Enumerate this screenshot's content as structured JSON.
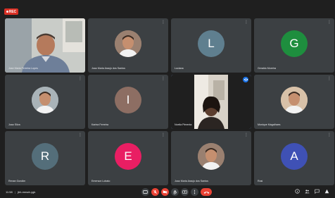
{
  "recording": {
    "label": "REC"
  },
  "participants": [
    {
      "name": "Jose Maria Ferreira Lopes",
      "type": "video",
      "scene": "man-office"
    },
    {
      "name": "Joao Maria Araujo dos Santos",
      "type": "photo",
      "avatar_color": "#9a8070"
    },
    {
      "name": "Luciana",
      "type": "letter",
      "letter": "L",
      "avatar_color": "#5f7f8f"
    },
    {
      "name": "Geraldo Moreira",
      "type": "letter",
      "letter": "G",
      "avatar_color": "#1e8e3e"
    },
    {
      "name": "Joao Silva",
      "type": "photo",
      "avatar_color": "#a9b3b8"
    },
    {
      "name": "Karina Ferreira",
      "type": "letter",
      "letter": "I",
      "avatar_color": "#8d6e63"
    },
    {
      "name": "Noelia Pimenta",
      "type": "video",
      "scene": "woman-room",
      "active": true
    },
    {
      "name": "Monique Magalhaes",
      "type": "photo",
      "avatar_color": "#d8c1a8"
    },
    {
      "name": "Renan Gondim",
      "type": "letter",
      "letter": "R",
      "avatar_color": "#546e7a"
    },
    {
      "name": "Emerson Lobato",
      "type": "letter",
      "letter": "E",
      "avatar_color": "#e91e63"
    },
    {
      "name": "Joao Maria Araujo dos Santos",
      "type": "photo",
      "avatar_color": "#9a8070"
    },
    {
      "name": "Rosi",
      "type": "letter",
      "letter": "A",
      "avatar_color": "#3f51b5"
    }
  ],
  "meeting": {
    "time": "11:58",
    "separator": "|",
    "code": "jbh-mnsdr-ygk"
  },
  "icons": {
    "more": "more-vertical-icon",
    "controls": [
      "captions-icon",
      "mic-off-icon",
      "camera-off-icon",
      "raise-hand-icon",
      "present-icon",
      "more-options-icon",
      "end-call-icon"
    ],
    "right": [
      "info-icon",
      "people-icon",
      "chat-icon",
      "activities-icon"
    ]
  },
  "colors": {
    "tile": "#3c4043",
    "background": "#1f1f1f",
    "active_border": "#8ab4f8",
    "end_call": "#ea4335"
  }
}
